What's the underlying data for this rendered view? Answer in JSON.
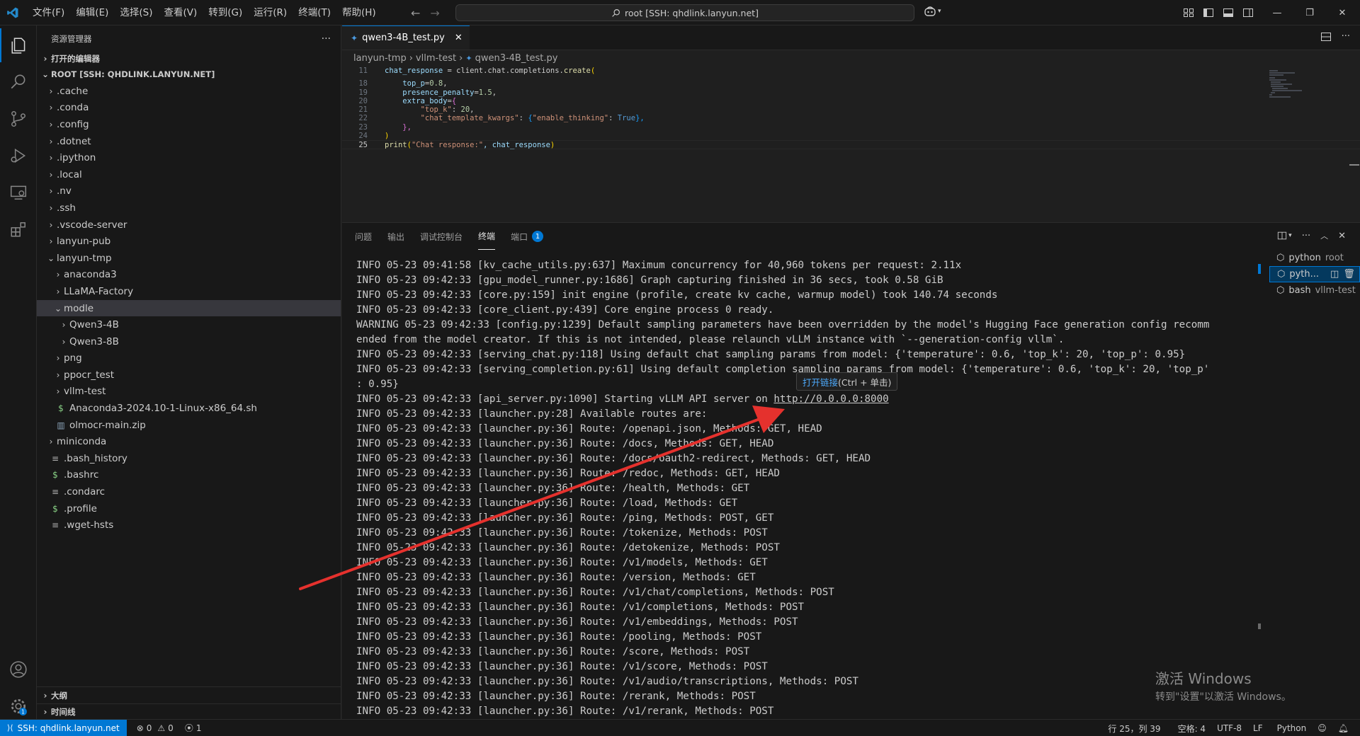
{
  "titlebar": {
    "menus": [
      "文件(F)",
      "编辑(E)",
      "选择(S)",
      "查看(V)",
      "转到(G)",
      "运行(R)",
      "终端(T)",
      "帮助(H)"
    ],
    "search_text": "root [SSH: qhdlink.lanyun.net]"
  },
  "sidebar": {
    "title": "资源管理器",
    "open_editors": "打开的编辑器",
    "root": "ROOT [SSH: QHDLINK.LANYUN.NET]",
    "items": [
      {
        "label": ".cache"
      },
      {
        "label": ".conda"
      },
      {
        "label": ".config"
      },
      {
        "label": ".dotnet"
      },
      {
        "label": ".ipython"
      },
      {
        "label": ".local"
      },
      {
        "label": ".nv"
      },
      {
        "label": ".ssh"
      },
      {
        "label": ".vscode-server"
      },
      {
        "label": "lanyun-pub"
      },
      {
        "label": "lanyun-tmp"
      },
      {
        "label": "anaconda3"
      },
      {
        "label": "LLaMA-Factory"
      },
      {
        "label": "modle"
      },
      {
        "label": "Qwen3-4B"
      },
      {
        "label": "Qwen3-8B"
      },
      {
        "label": "png"
      },
      {
        "label": "ppocr_test"
      },
      {
        "label": "vllm-test"
      },
      {
        "label": "Anaconda3-2024.10-1-Linux-x86_64.sh"
      },
      {
        "label": "olmocr-main.zip"
      },
      {
        "label": "miniconda"
      },
      {
        "label": ".bash_history"
      },
      {
        "label": ".bashrc"
      },
      {
        "label": ".condarc"
      },
      {
        "label": ".profile"
      },
      {
        "label": ".wget-hsts"
      }
    ],
    "outline": "大纲",
    "timeline": "时间线"
  },
  "editor": {
    "tab_label": "qwen3-4B_test.py",
    "breadcrumb": [
      "lanyun-tmp",
      "vllm-test",
      "qwen3-4B_test.py"
    ],
    "line_numbers": [
      "11",
      "18",
      "19",
      "20",
      "21",
      "22",
      "23",
      "24",
      "25"
    ],
    "lines": {
      "l11a": "chat_response",
      "l11b": " = client.chat.completions.",
      "l11c": "create",
      "l18a": "top_p",
      "l18b": "=",
      "l18c": "0.8",
      "l18d": ",",
      "l19a": "presence_penalty",
      "l19b": "=",
      "l19c": "1.5",
      "l19d": ",",
      "l20a": "extra_body",
      "l20b": "=",
      "l21a": "\"top_k\"",
      "l21b": ": ",
      "l21c": "20",
      "l21d": ",",
      "l22a": "\"chat_template_kwargs\"",
      "l22b": ": ",
      "l22c": "\"enable_thinking\"",
      "l22d": ": ",
      "l22e": "True",
      "l22f": "},",
      "l23a": "},",
      "l24a": ")",
      "l25a": "print",
      "l25b": "(",
      "l25c": "\"Chat response:\"",
      "l25d": ", chat_response",
      "l25e": ")"
    }
  },
  "panel": {
    "tabs": [
      "问题",
      "输出",
      "调试控制台",
      "终端",
      "端口"
    ],
    "ports_badge": "1",
    "tooltip_link": "打开链接",
    "tooltip_hint": " (Ctrl + 单击)",
    "terminal_lines": [
      "INFO 05-23 09:41:58 [kv_cache_utils.py:637] Maximum concurrency for 40,960 tokens per request: 2.11x",
      "INFO 05-23 09:42:33 [gpu_model_runner.py:1686] Graph capturing finished in 36 secs, took 0.58 GiB",
      "INFO 05-23 09:42:33 [core.py:159] init engine (profile, create kv cache, warmup model) took 140.74 seconds",
      "INFO 05-23 09:42:33 [core_client.py:439] Core engine process 0 ready.",
      "WARNING 05-23 09:42:33 [config.py:1239] Default sampling parameters have been overridden by the model's Hugging Face generation config recomm",
      "ended from the model creator. If this is not intended, please relaunch vLLM instance with `--generation-config vllm`.",
      "INFO 05-23 09:42:33 [serving_chat.py:118] Using default chat sampling params from model: {'temperature': 0.6, 'top_k': 20, 'top_p': 0.95}",
      "INFO 05-23 09:42:33 [serving_completion.py:61] Using default completion sampling params from model: {'temperature': 0.6, 'top_k': 20, 'top_p'",
      ": 0.95}",
      "INFO 05-23 09:42:33 [api_server.py:1090] Starting vLLM API server on ",
      "INFO 05-23 09:42:33 [launcher.py:28] Available routes are:",
      "INFO 05-23 09:42:33 [launcher.py:36] Route: /openapi.json, Methods: GET, HEAD",
      "INFO 05-23 09:42:33 [launcher.py:36] Route: /docs, Methods: GET, HEAD",
      "INFO 05-23 09:42:33 [launcher.py:36] Route: /docs/oauth2-redirect, Methods: GET, HEAD",
      "INFO 05-23 09:42:33 [launcher.py:36] Route: /redoc, Methods: GET, HEAD",
      "INFO 05-23 09:42:33 [launcher.py:36] Route: /health, Methods: GET",
      "INFO 05-23 09:42:33 [launcher.py:36] Route: /load, Methods: GET",
      "INFO 05-23 09:42:33 [launcher.py:36] Route: /ping, Methods: POST, GET",
      "INFO 05-23 09:42:33 [launcher.py:36] Route: /tokenize, Methods: POST",
      "INFO 05-23 09:42:33 [launcher.py:36] Route: /detokenize, Methods: POST",
      "INFO 05-23 09:42:33 [launcher.py:36] Route: /v1/models, Methods: GET",
      "INFO 05-23 09:42:33 [launcher.py:36] Route: /version, Methods: GET",
      "INFO 05-23 09:42:33 [launcher.py:36] Route: /v1/chat/completions, Methods: POST",
      "INFO 05-23 09:42:33 [launcher.py:36] Route: /v1/completions, Methods: POST",
      "INFO 05-23 09:42:33 [launcher.py:36] Route: /v1/embeddings, Methods: POST",
      "INFO 05-23 09:42:33 [launcher.py:36] Route: /pooling, Methods: POST",
      "INFO 05-23 09:42:33 [launcher.py:36] Route: /score, Methods: POST",
      "INFO 05-23 09:42:33 [launcher.py:36] Route: /v1/score, Methods: POST",
      "INFO 05-23 09:42:33 [launcher.py:36] Route: /v1/audio/transcriptions, Methods: POST",
      "INFO 05-23 09:42:33 [launcher.py:36] Route: /rerank, Methods: POST",
      "INFO 05-23 09:42:33 [launcher.py:36] Route: /v1/rerank, Methods: POST"
    ],
    "server_url": "http://0.0.0.0:8000",
    "terminals": [
      {
        "name": "python",
        "sub": "root"
      },
      {
        "name": "pyth...",
        "sub": ""
      },
      {
        "name": "bash",
        "sub": "vllm-test"
      }
    ]
  },
  "watermark": {
    "title": "激活 Windows",
    "subtitle": "转到\"设置\"以激活 Windows。"
  },
  "statusbar": {
    "remote": "SSH: qhdlink.lanyun.net",
    "errors": "0",
    "warnings": "0",
    "ports": "1",
    "position": "行 25，列 39",
    "spaces": "空格: 4",
    "encoding": "UTF-8",
    "eol": "LF",
    "language": "Python"
  },
  "colors": {
    "accent": "#0078d4",
    "arrow": "#e5312d"
  }
}
